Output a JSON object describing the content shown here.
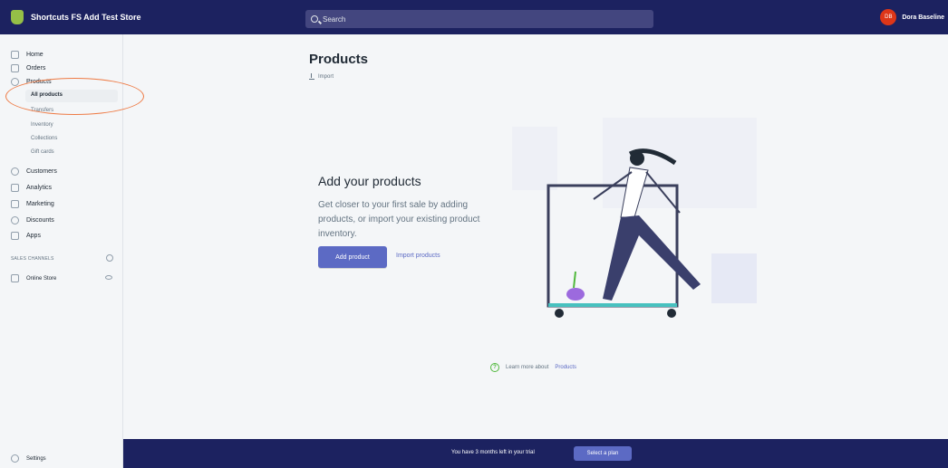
{
  "topbar": {
    "store_name": "Shortcuts FS Add Test Store",
    "search_placeholder": "Search",
    "user_initials": "DB",
    "user_name": "Dora Baseline"
  },
  "sidebar": {
    "items": [
      {
        "label": "Home"
      },
      {
        "label": "Orders"
      },
      {
        "label": "Products"
      },
      {
        "label": "Customers"
      },
      {
        "label": "Analytics"
      },
      {
        "label": "Marketing"
      },
      {
        "label": "Discounts"
      },
      {
        "label": "Apps"
      }
    ],
    "product_subitems": [
      {
        "label": "All products"
      },
      {
        "label": "Transfers"
      },
      {
        "label": "Inventory"
      },
      {
        "label": "Collections"
      },
      {
        "label": "Gift cards"
      }
    ],
    "sales_channels_label": "SALES CHANNELS",
    "online_store_label": "Online Store",
    "settings_label": "Settings"
  },
  "main": {
    "title": "Products",
    "import_label": "Import",
    "empty_heading": "Add your products",
    "empty_text": "Get closer to your first sale by adding products, or import your existing product inventory.",
    "add_product_label": "Add product",
    "import_products_label": "Import products",
    "learn_prefix": "Learn more about",
    "learn_link": "Products"
  },
  "trial": {
    "text": "You have 3 months left in your trial",
    "button": "Select a plan"
  },
  "colors": {
    "topbar": "#1c2260",
    "primary": "#5c6ac4",
    "highlight": "#ee7a44"
  }
}
